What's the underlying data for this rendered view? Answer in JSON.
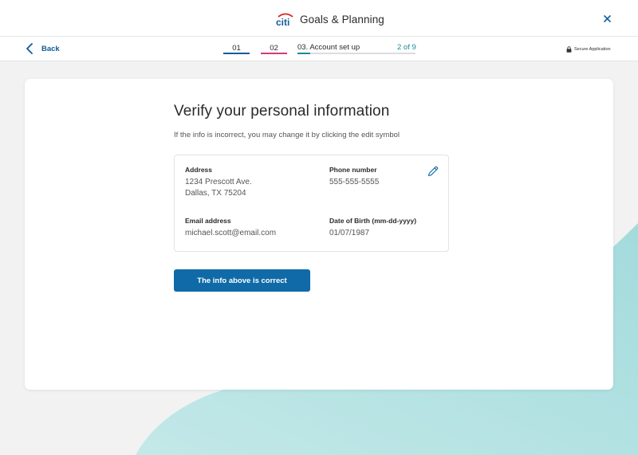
{
  "header": {
    "brand": "citi",
    "title": "Goals & Planning",
    "close_icon": "close-icon"
  },
  "nav": {
    "back_label": "Back",
    "steps": [
      {
        "label": "01",
        "color": "#0f5c9c"
      },
      {
        "label": "02",
        "color": "#d23a7c"
      }
    ],
    "current_step": {
      "label": "03. Account set up",
      "count": "2 of 9",
      "progress": 0.11,
      "color": "#148c97"
    },
    "secure_label": "Secure Application"
  },
  "main": {
    "title": "Verify your personal information",
    "subtitle": "If the info is incorrect, you may change it by clicking the edit symbol",
    "fields": {
      "address": {
        "label": "Address",
        "line1": "1234 Prescott Ave.",
        "line2": "Dallas, TX 75204"
      },
      "phone": {
        "label": "Phone number",
        "value": "555-555-5555"
      },
      "email": {
        "label": "Email address",
        "value": "michael.scott@email.com"
      },
      "dob": {
        "label": "Date of Birth (mm-dd-yyyy)",
        "value": "01/07/1987"
      }
    },
    "edit_icon": "pencil-icon",
    "confirm_label": "The info above is correct"
  },
  "colors": {
    "primary": "#0f6aa7",
    "accent_teal": "#148c97",
    "accent_pink": "#d23a7c",
    "background_wave": "#a9dfe0"
  }
}
